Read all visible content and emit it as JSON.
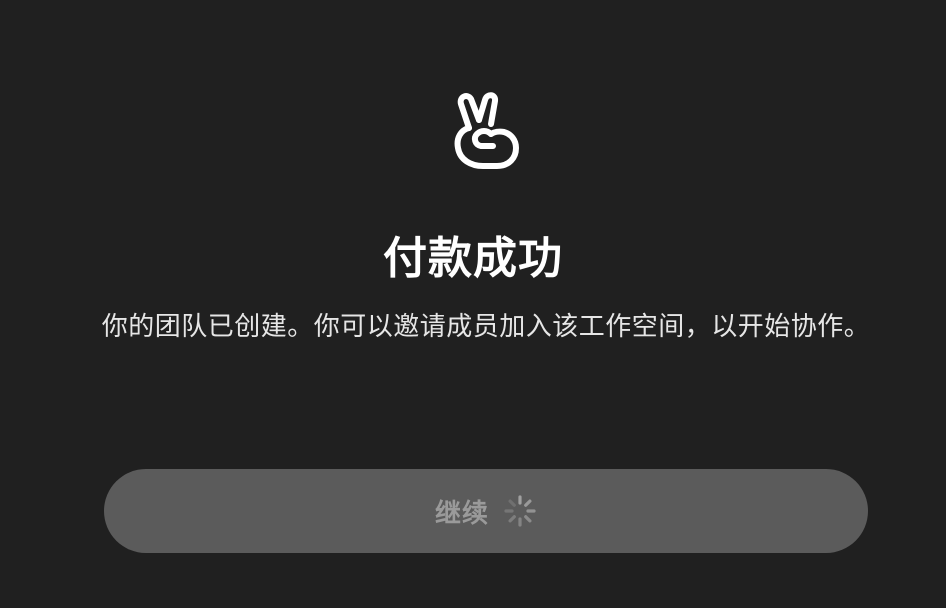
{
  "page": {
    "title": "付款成功",
    "description": "你的团队已创建。你可以邀请成员加入该工作空间，以开始协作。",
    "icon": "victory-hand-icon"
  },
  "continue_button": {
    "label": "继续",
    "state": "loading",
    "spinner_icon": "loading-spinner-icon"
  },
  "colors": {
    "background": "#202020",
    "button_background": "#5b5b5b",
    "button_text": "#9a9a9a",
    "text": "#ffffff"
  }
}
